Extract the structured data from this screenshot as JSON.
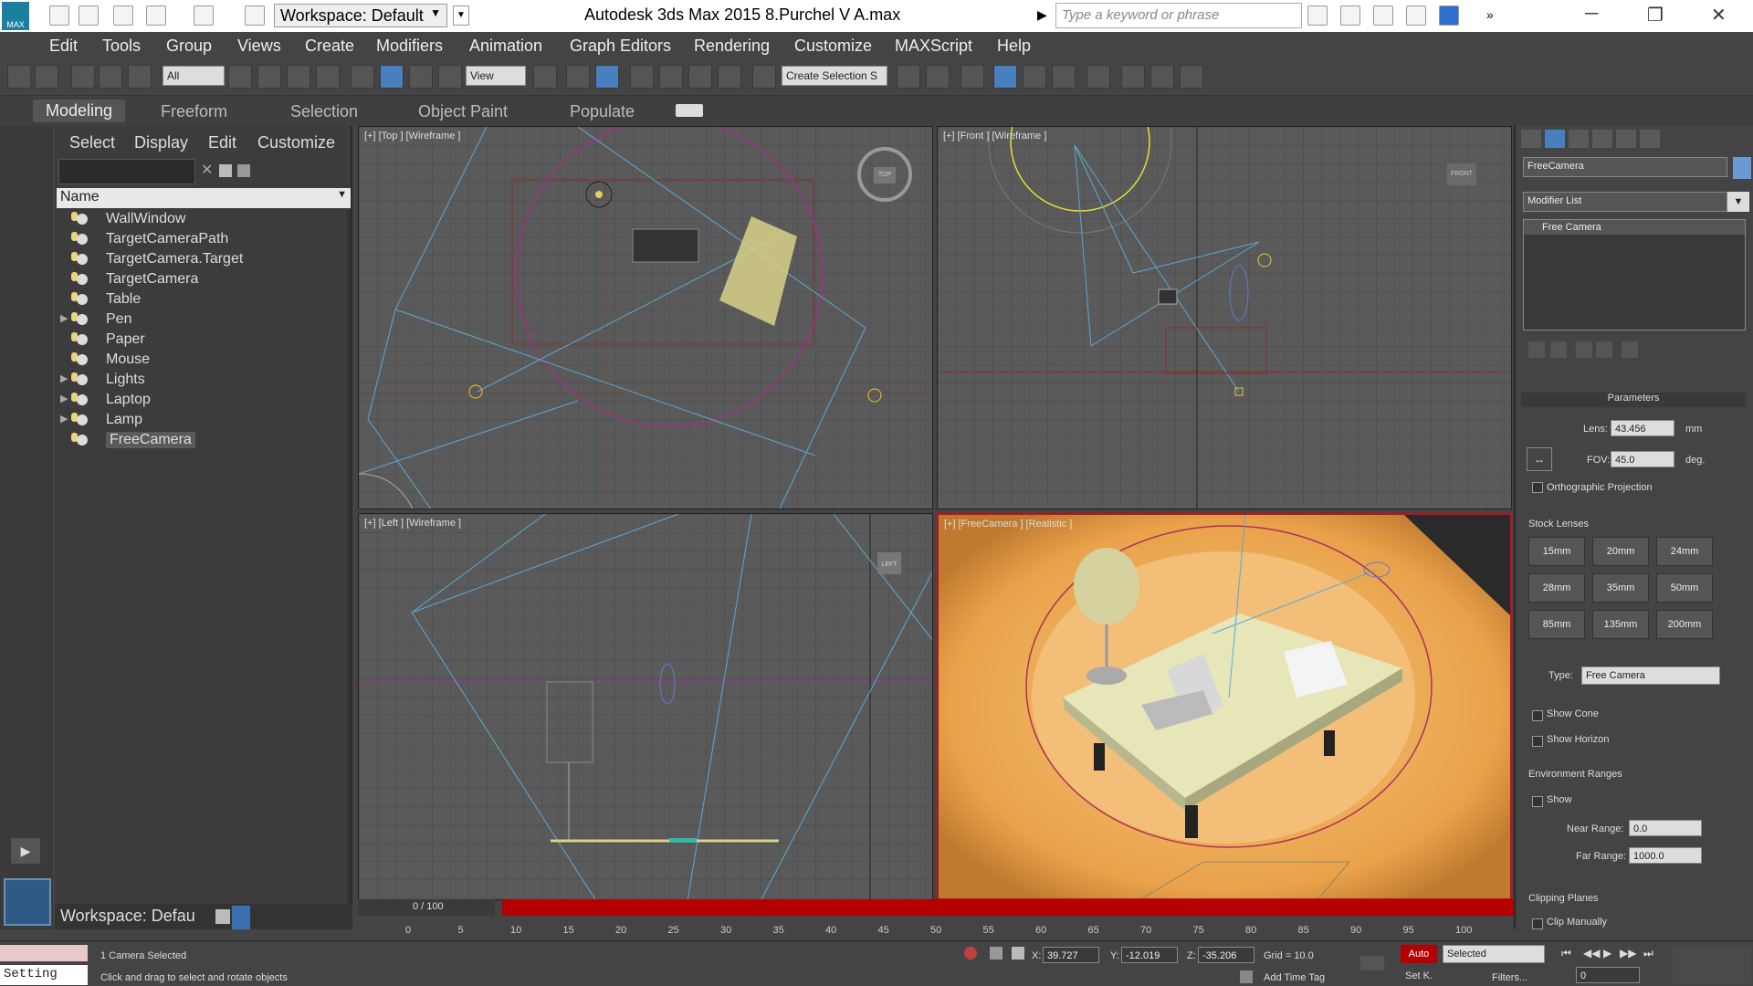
{
  "app": {
    "title": "Autodesk 3ds Max  2015      8.Purchel V A.max",
    "logo": "MAX",
    "workspace": "Workspace: Default",
    "search_placeholder": "Type a keyword or phrase"
  },
  "menu": [
    "Edit",
    "Tools",
    "Group",
    "Views",
    "Create",
    "Modifiers",
    "Animation",
    "Graph Editors",
    "Rendering",
    "Customize",
    "MAXScript",
    "Help"
  ],
  "maintoolbar": {
    "filter": "All",
    "refcoord": "View",
    "selset": "Create Selection S"
  },
  "ribbon": [
    "Modeling",
    "Freeform",
    "Selection",
    "Object Paint",
    "Populate"
  ],
  "scene": {
    "tabs": [
      "Select",
      "Display",
      "Edit",
      "Customize"
    ],
    "name_header": "Name",
    "items": [
      {
        "label": "WallWindow",
        "exp": false
      },
      {
        "label": "TargetCameraPath",
        "exp": false
      },
      {
        "label": "TargetCamera.Target",
        "exp": false
      },
      {
        "label": "TargetCamera",
        "exp": false
      },
      {
        "label": "Table",
        "exp": false
      },
      {
        "label": "Pen",
        "exp": true
      },
      {
        "label": "Paper",
        "exp": false
      },
      {
        "label": "Mouse",
        "exp": false
      },
      {
        "label": "Lights",
        "exp": true
      },
      {
        "label": "Laptop",
        "exp": true
      },
      {
        "label": "Lamp",
        "exp": true
      },
      {
        "label": "FreeCamera",
        "exp": false,
        "selected": true
      }
    ],
    "workspace": "Workspace: Defau"
  },
  "viewports": {
    "top": "[+] [Top ] [Wireframe ]",
    "front": "[+] [Front ] [Wireframe ]",
    "left": "[+] [Left ] [Wireframe ]",
    "camera": "[+] [FreeCamera ] [Realistic ]",
    "cube_top": "TOP",
    "cube_front": "FRONT",
    "cube_left": "LEFT"
  },
  "command": {
    "object_name": "FreeCamera",
    "modifier_list": "Modifier List",
    "stack_item": "Free Camera",
    "parameters": "Parameters",
    "lens_label": "Lens:",
    "lens": "43.456",
    "lens_unit": "mm",
    "fov_label": "FOV:",
    "fov": "45.0",
    "fov_unit": "deg.",
    "ortho": "Orthographic Projection",
    "stock": "Stock Lenses",
    "lenses": [
      "15mm",
      "20mm",
      "24mm",
      "28mm",
      "35mm",
      "50mm",
      "85mm",
      "135mm",
      "200mm"
    ],
    "type_label": "Type:",
    "type": "Free Camera",
    "show_cone": "Show Cone",
    "show_horizon": "Show Horizon",
    "env": "Environment Ranges",
    "show": "Show",
    "near_label": "Near Range:",
    "near": "0.0",
    "far_label": "Far Range:",
    "far": "1000.0",
    "clip": "Clipping Planes",
    "clip_manual": "Clip Manually"
  },
  "timeline": {
    "frame": "0 / 100",
    "ticks": [
      "0",
      "5",
      "10",
      "15",
      "20",
      "25",
      "30",
      "35",
      "40",
      "45",
      "50",
      "55",
      "60",
      "65",
      "70",
      "75",
      "80",
      "85",
      "90",
      "95",
      "100"
    ]
  },
  "status": {
    "listener": "Setting",
    "selected": "1 Camera Selected",
    "prompt": "Click and drag to select and rotate objects",
    "x_label": "X:",
    "x": "39.727",
    "y_label": "Y:",
    "y": "-12.019",
    "z_label": "Z:",
    "z": "-35.206",
    "grid": "Grid = 10.0",
    "add_time_tag": "Add Time Tag",
    "auto": "Auto",
    "set_key": "Set K.",
    "sel_filter": "Selected",
    "filters": "Filters...",
    "frame": "0"
  }
}
